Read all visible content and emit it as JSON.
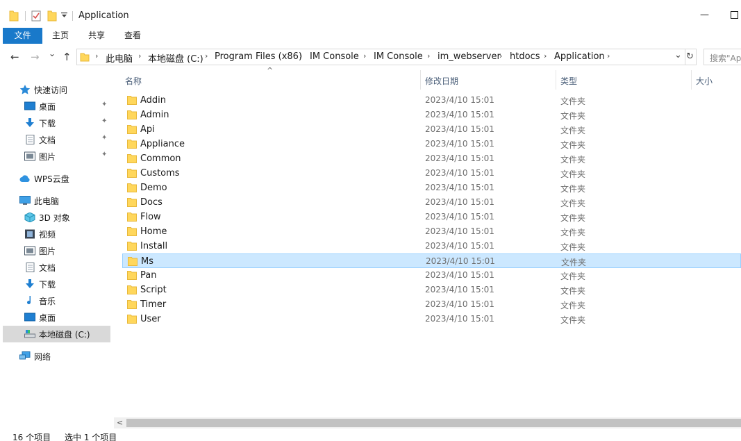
{
  "window": {
    "title": "Application",
    "minimize_glyph": "—",
    "maximize_glyph": "☐"
  },
  "ribbon": {
    "tabs": [
      {
        "label": "文件",
        "active": true
      },
      {
        "label": "主页"
      },
      {
        "label": "共享"
      },
      {
        "label": "查看"
      }
    ]
  },
  "address_bar": {
    "segments": [
      "此电脑",
      "本地磁盘 (C:)",
      "Program Files (x86)",
      "IM Console",
      "IM Console",
      "im_webserver",
      "htdocs",
      "Application"
    ],
    "separator": "›",
    "dropdown_glyph": "⌄",
    "refresh_glyph": "↻"
  },
  "search": {
    "placeholder": "搜索\"Application\""
  },
  "nav": {
    "back_glyph": "←",
    "forward_glyph": "→",
    "recent_glyph": "⌄",
    "up_glyph": "↑"
  },
  "navigation_pane": {
    "items": [
      {
        "label": "快速访问",
        "icon": "star-icon",
        "level": 0
      },
      {
        "label": "桌面",
        "icon": "desktop-icon",
        "level": 1,
        "pinned": true
      },
      {
        "label": "下载",
        "icon": "download-icon",
        "level": 1,
        "pinned": true
      },
      {
        "label": "文档",
        "icon": "document-icon",
        "level": 1,
        "pinned": true
      },
      {
        "label": "图片",
        "icon": "picture-icon",
        "level": 1,
        "pinned": true
      },
      {
        "label": "WPS云盘",
        "icon": "cloud-icon",
        "level": 0
      },
      {
        "label": "此电脑",
        "icon": "computer-icon",
        "level": 0
      },
      {
        "label": "3D 对象",
        "icon": "cube-icon",
        "level": 1
      },
      {
        "label": "视频",
        "icon": "video-icon",
        "level": 1
      },
      {
        "label": "图片",
        "icon": "picture-icon",
        "level": 1
      },
      {
        "label": "文档",
        "icon": "document-icon",
        "level": 1
      },
      {
        "label": "下载",
        "icon": "download-icon",
        "level": 1
      },
      {
        "label": "音乐",
        "icon": "music-icon",
        "level": 1
      },
      {
        "label": "桌面",
        "icon": "desktop-icon",
        "level": 1
      },
      {
        "label": "本地磁盘 (C:)",
        "icon": "drive-icon",
        "level": 1,
        "selected": true
      },
      {
        "label": "网络",
        "icon": "network-icon",
        "level": 0
      }
    ],
    "pin_glyph": "📌"
  },
  "columns": {
    "name": "名称",
    "date": "修改日期",
    "type": "类型",
    "size": "大小",
    "sort_glyph": "^"
  },
  "files": [
    {
      "name": "Addin",
      "date": "2023/4/10 15:01",
      "type": "文件夹"
    },
    {
      "name": "Admin",
      "date": "2023/4/10 15:01",
      "type": "文件夹"
    },
    {
      "name": "Api",
      "date": "2023/4/10 15:01",
      "type": "文件夹"
    },
    {
      "name": "Appliance",
      "date": "2023/4/10 15:01",
      "type": "文件夹"
    },
    {
      "name": "Common",
      "date": "2023/4/10 15:01",
      "type": "文件夹"
    },
    {
      "name": "Customs",
      "date": "2023/4/10 15:01",
      "type": "文件夹"
    },
    {
      "name": "Demo",
      "date": "2023/4/10 15:01",
      "type": "文件夹"
    },
    {
      "name": "Docs",
      "date": "2023/4/10 15:01",
      "type": "文件夹"
    },
    {
      "name": "Flow",
      "date": "2023/4/10 15:01",
      "type": "文件夹"
    },
    {
      "name": "Home",
      "date": "2023/4/10 15:01",
      "type": "文件夹"
    },
    {
      "name": "Install",
      "date": "2023/4/10 15:01",
      "type": "文件夹"
    },
    {
      "name": "Ms",
      "date": "2023/4/10 15:01",
      "type": "文件夹",
      "selected": true
    },
    {
      "name": "Pan",
      "date": "2023/4/10 15:01",
      "type": "文件夹"
    },
    {
      "name": "Script",
      "date": "2023/4/10 15:01",
      "type": "文件夹"
    },
    {
      "name": "Timer",
      "date": "2023/4/10 15:01",
      "type": "文件夹"
    },
    {
      "name": "User",
      "date": "2023/4/10 15:01",
      "type": "文件夹"
    }
  ],
  "status": {
    "count": "16 个项目",
    "selection": "选中 1 个项目"
  },
  "scrollbar": {
    "left_glyph": "<"
  },
  "colors": {
    "accent": "#1979ca",
    "selection": "#cce8ff",
    "folder": "#ffd75c",
    "folder_dark": "#e8b83a"
  }
}
